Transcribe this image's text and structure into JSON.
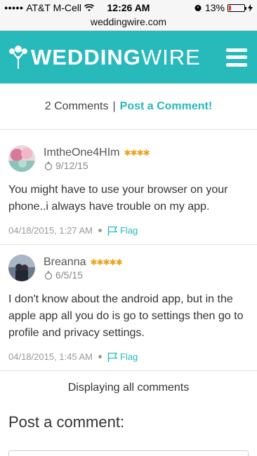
{
  "status_bar": {
    "carrier": "AT&T M-Cell",
    "time": "12:26 AM",
    "battery": "13%",
    "battery_level": 0.13,
    "url": "weddingwire.com"
  },
  "header": {
    "logo_bold": "WEDDING",
    "logo_light": "WIRE",
    "menu_icon": "hamburger-icon",
    "brand_color": "#28b9bb"
  },
  "summary": {
    "count_text": "2 Comments",
    "separator": "|",
    "post_link": "Post a Comment!"
  },
  "comments": [
    {
      "author": "ImtheOne4HIm",
      "stars": "✱✱✱✱",
      "wedding_date": "9/12/15",
      "body": "You might have to use your browser on your phone..i always have trouble on my app.",
      "timestamp": "04/18/2015, 1:27 AM",
      "flag": "Flag"
    },
    {
      "author": "Breanna",
      "stars": "✱✱✱✱✱",
      "wedding_date": "6/5/15",
      "body": "I don't know about the android app, but in the apple app all you do is go to settings then go to profile and privacy settings.",
      "timestamp": "04/18/2015, 1:45 AM",
      "flag": "Flag"
    }
  ],
  "footer": {
    "all_comments": "Displaying all comments",
    "post_heading": "Post a comment:"
  }
}
